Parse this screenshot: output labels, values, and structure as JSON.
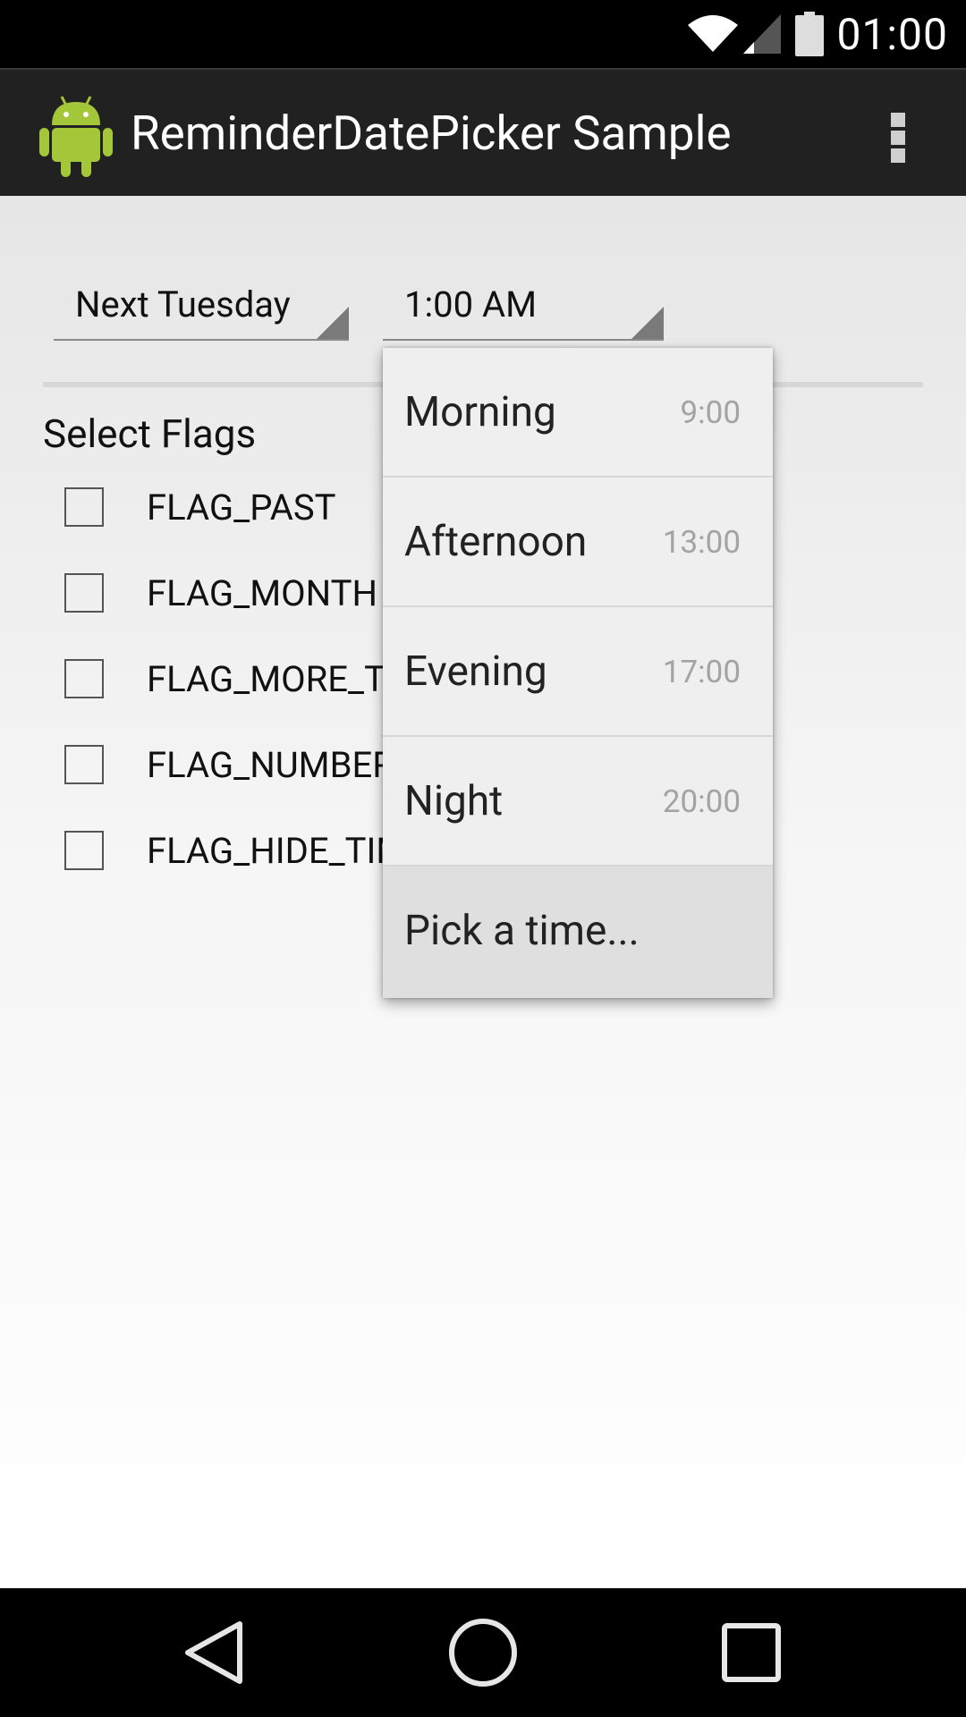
{
  "status_bar": {
    "time": "01:00",
    "icons": [
      "wifi-icon",
      "cell-signal-icon",
      "battery-icon"
    ]
  },
  "action_bar": {
    "title": "ReminderDatePicker Sample",
    "app_icon": "android-robot-icon",
    "overflow_icon": "overflow-menu-icon"
  },
  "date_spinner": {
    "value": "Next Tuesday"
  },
  "time_spinner": {
    "value": "1:00 AM"
  },
  "flags": {
    "title": "Select Flags",
    "items": [
      {
        "label": "FLAG_PAST",
        "checked": false
      },
      {
        "label": "FLAG_MONTH",
        "checked": false
      },
      {
        "label": "FLAG_MORE_TI",
        "checked": false
      },
      {
        "label": "FLAG_NUMBER",
        "checked": false
      },
      {
        "label": "FLAG_HIDE_TIM",
        "checked": false
      }
    ]
  },
  "time_dropdown": {
    "items": [
      {
        "label": "Morning",
        "time": "9:00"
      },
      {
        "label": "Afternoon",
        "time": "13:00"
      },
      {
        "label": "Evening",
        "time": "17:00"
      },
      {
        "label": "Night",
        "time": "20:00"
      },
      {
        "label": "Pick a time...",
        "time": ""
      }
    ]
  },
  "nav_bar": {
    "icons": [
      "back-icon",
      "home-icon",
      "recents-icon"
    ]
  },
  "colors": {
    "status_bar": "#000000",
    "action_bar": "#212121",
    "android_green": "#A4C639",
    "dropdown_bg": "#EFEFEF",
    "dropdown_highlight": "#DFDFDF"
  }
}
